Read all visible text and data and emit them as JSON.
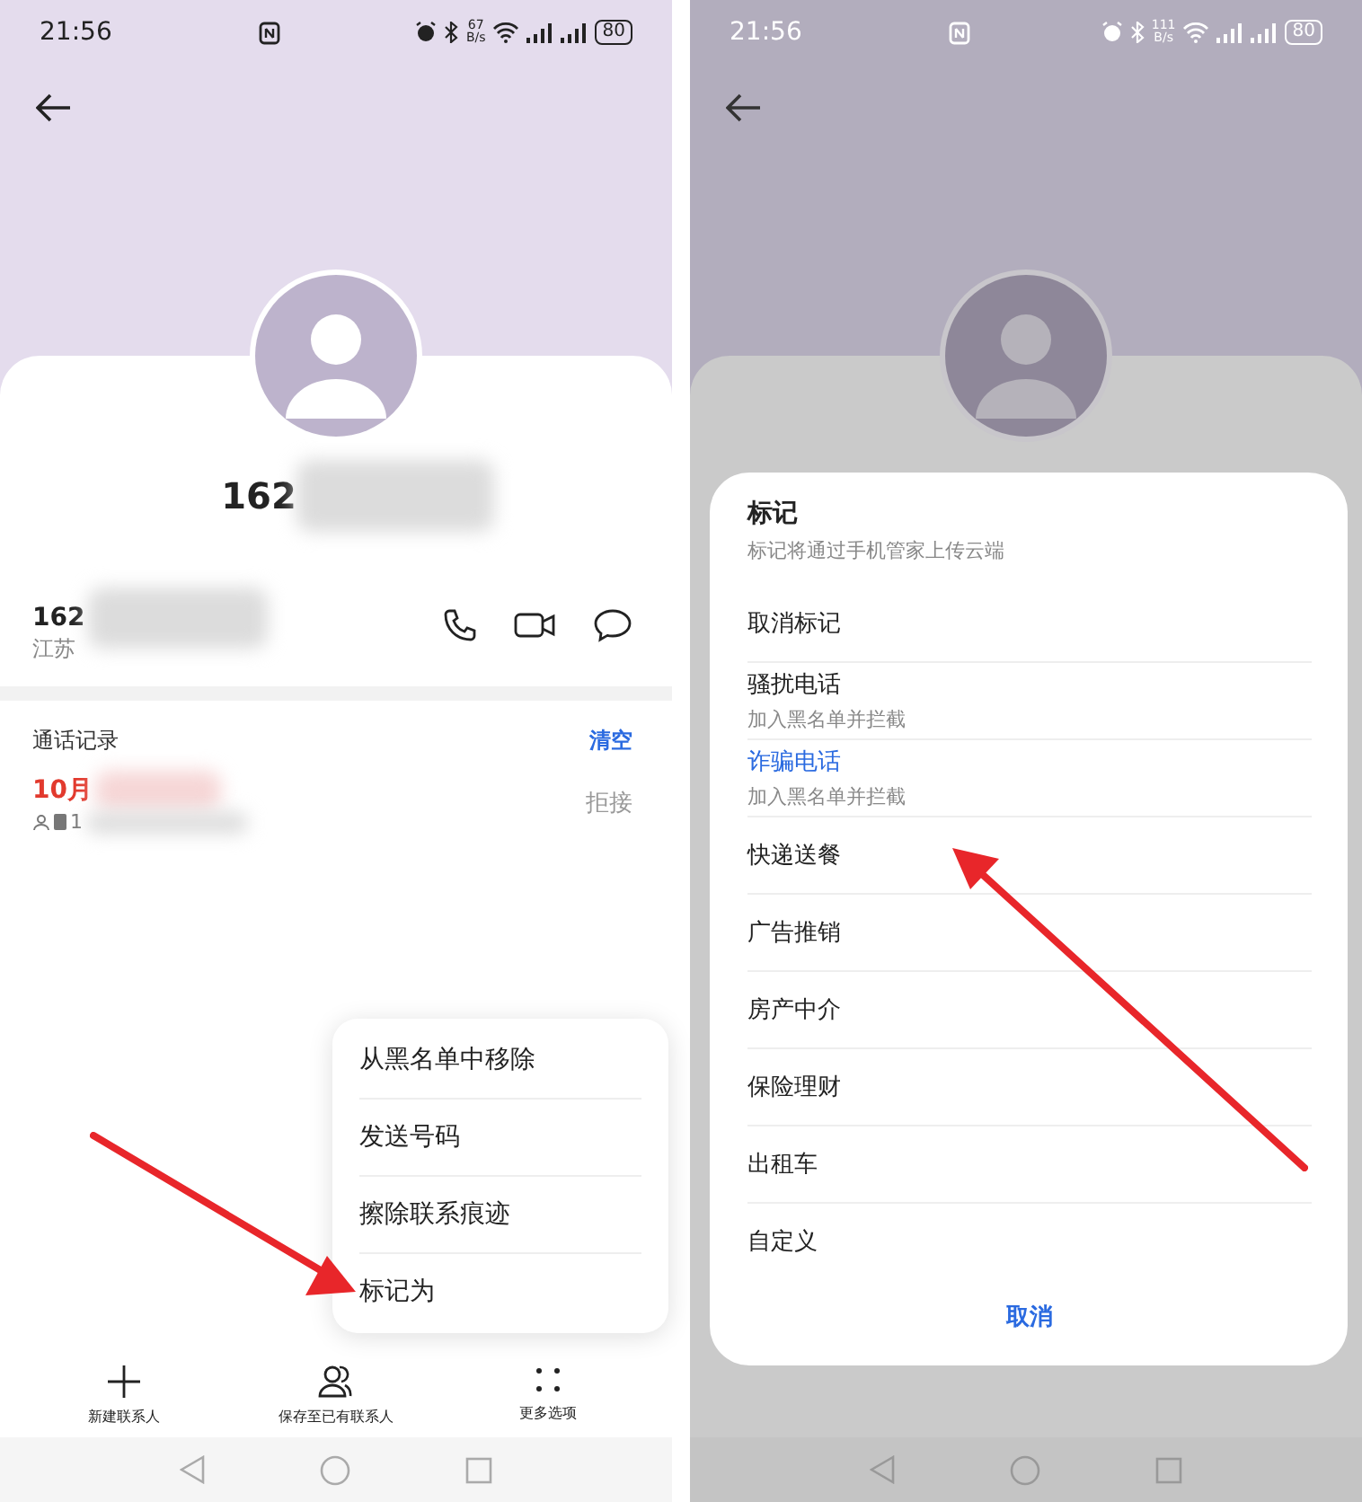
{
  "screens": [
    {
      "kind": "contact",
      "dimmed": false,
      "status_bar": {
        "time": "21:56",
        "speed_value": "67",
        "speed_unit": "B/s",
        "battery": "80"
      },
      "contact": {
        "name": "162",
        "number": "162",
        "location": "江苏"
      },
      "call_log": {
        "title": "通话记录",
        "clear": "清空",
        "entries": [
          {
            "date": "10月",
            "detail": "1",
            "status": "拒接"
          }
        ]
      },
      "popup_menu": [
        {
          "label": "从黑名单中移除"
        },
        {
          "label": "发送号码"
        },
        {
          "label": "擦除联系痕迹"
        },
        {
          "label": "标记为"
        }
      ],
      "toolbar": [
        {
          "kind": "add",
          "label": "新建联系人"
        },
        {
          "kind": "person",
          "label": "保存至已有联系人"
        },
        {
          "kind": "more",
          "label": "更多选项"
        }
      ],
      "annotation": {
        "kind": "arrow"
      }
    },
    {
      "kind": "mark_dialog",
      "dimmed": true,
      "status_bar": {
        "time": "21:56",
        "speed_value": "111",
        "speed_unit": "B/s",
        "battery": "80"
      },
      "dialog": {
        "title": "标记",
        "subtitle": "标记将通过手机管家上传云端",
        "options": [
          {
            "label": "取消标记",
            "selected": false
          },
          {
            "label": "骚扰电话",
            "sub": "加入黑名单并拦截",
            "selected": false
          },
          {
            "label": "诈骗电话",
            "sub": "加入黑名单并拦截",
            "selected": true
          },
          {
            "label": "快递送餐",
            "selected": false
          },
          {
            "label": "广告推销",
            "selected": false
          },
          {
            "label": "房产中介",
            "selected": false
          },
          {
            "label": "保险理财",
            "selected": false
          },
          {
            "label": "出租车",
            "selected": false
          },
          {
            "label": "自定义",
            "selected": false
          }
        ],
        "cancel": "取消"
      },
      "annotation": {
        "kind": "arrow"
      }
    }
  ]
}
